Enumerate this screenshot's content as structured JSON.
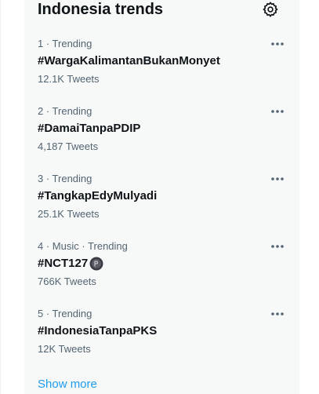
{
  "panel": {
    "title": "Indonesia trends",
    "settings_icon": "gear-icon",
    "more_icon": "more-horizontal-icon",
    "show_more": "Show more",
    "accent_color": "#1d9bf0"
  },
  "trends": [
    {
      "meta": "1 · Trending",
      "name": "#WargaKalimantanBukanMonyet",
      "count": "12.1K Tweets"
    },
    {
      "meta": "2 · Trending",
      "name": "#DamaiTanpaPDIP",
      "count": "4,187 Tweets"
    },
    {
      "meta": "3 · Trending",
      "name": "#TangkapEdyMulyadi",
      "count": "25.1K Tweets"
    },
    {
      "meta": "4 · Music · Trending",
      "name": "#NCT127",
      "count": "766K Tweets",
      "badge_icon": "nct-hashflag-icon"
    },
    {
      "meta": "5 · Trending",
      "name": "#IndonesiaTanpaPKS",
      "count": "12K Tweets"
    }
  ]
}
